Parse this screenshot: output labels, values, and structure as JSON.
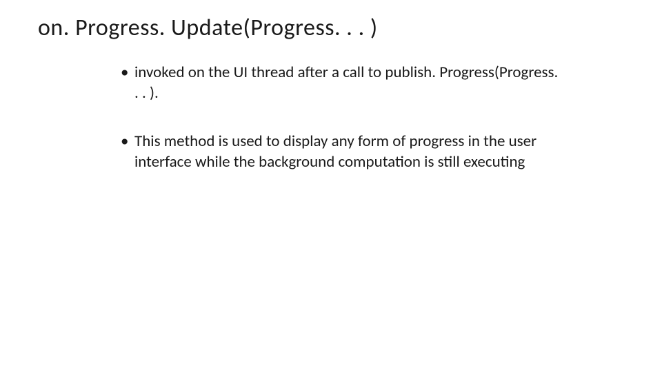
{
  "slide": {
    "title": "on. Progress. Update(Progress. . . )",
    "bullets": [
      "invoked on the UI thread after a call to publish. Progress(Progress. . . ).",
      " This method is used to display any form of progress in the user interface while the background computation is still executing"
    ]
  }
}
